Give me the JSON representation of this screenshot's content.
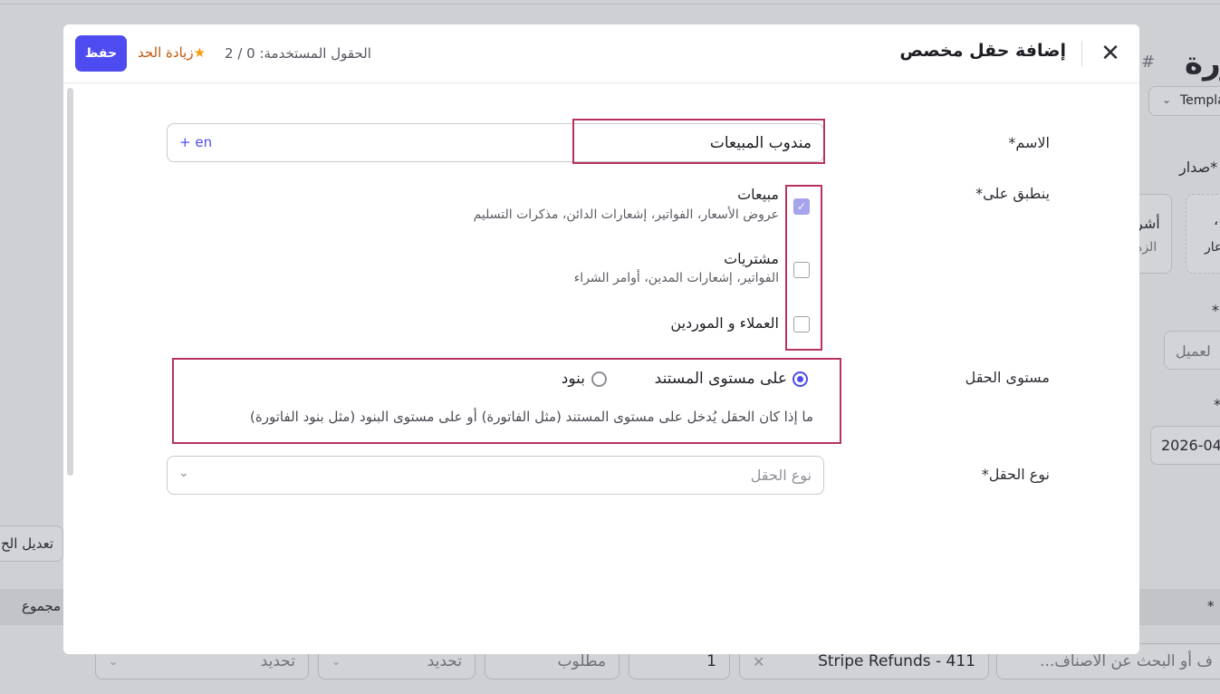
{
  "background": {
    "page_title_fragment": "ورة",
    "hash_symbol": "#",
    "template_dropdown": "Templa",
    "issue_label_fragment": "صدار*",
    "card_left_title": "أشر",
    "card_left_sub": "الزه",
    "card_right_title": "،",
    "card_right_sub": "عار",
    "asterisk_1": "*",
    "customer_field_fragment": "لعميل",
    "asterisk_2": "*",
    "date_fragment": "2026-04",
    "edit_button_fragment": "تعديل الح",
    "total_header_fragment": "مجموع",
    "asterisk_3": "*",
    "row": {
      "select_1": "تحديد",
      "select_2": "تحديد",
      "required_field": "مطلوب",
      "quantity": "1",
      "product": "Stripe Refunds - 411",
      "search_fragment": "ف أو البحث عن الأصناف..."
    }
  },
  "modal": {
    "title": "إضافة حقل مخصص",
    "fields_used": "الحقول المستخدمة: 0 / 2",
    "increase_limit": "زيادة الحد",
    "save_label": "حفظ",
    "name": {
      "label": "الاسم*",
      "value": "مندوب المبيعات",
      "lang_button": "+ en"
    },
    "applies_to": {
      "label": "ينطبق على*",
      "options": [
        {
          "title": "مبيعات",
          "description": "عروض الأسعار، الفواتير، إشعارات الدائن، مذكرات التسليم",
          "checked": true
        },
        {
          "title": "مشتريات",
          "description": "الفواتير، إشعارات المدين، أوامر الشراء",
          "checked": false
        },
        {
          "title": "العملاء و الموردين",
          "description": "",
          "checked": false
        }
      ]
    },
    "field_level": {
      "label": "مستوى الحقل",
      "options": [
        {
          "label": "على مستوى المستند",
          "selected": true
        },
        {
          "label": "بنود",
          "selected": false
        }
      ],
      "hint": "ما إذا كان الحقل يُدخل على مستوى المستند (مثل الفاتورة) أو على مستوى البنود (مثل بنود الفاتورة)"
    },
    "field_type": {
      "label": "نوع الحقل*",
      "placeholder": "نوع الحقل"
    }
  },
  "colors": {
    "accent": "#4e4cf0",
    "highlight_border": "#b8325e",
    "limit_link": "#c2570b"
  }
}
